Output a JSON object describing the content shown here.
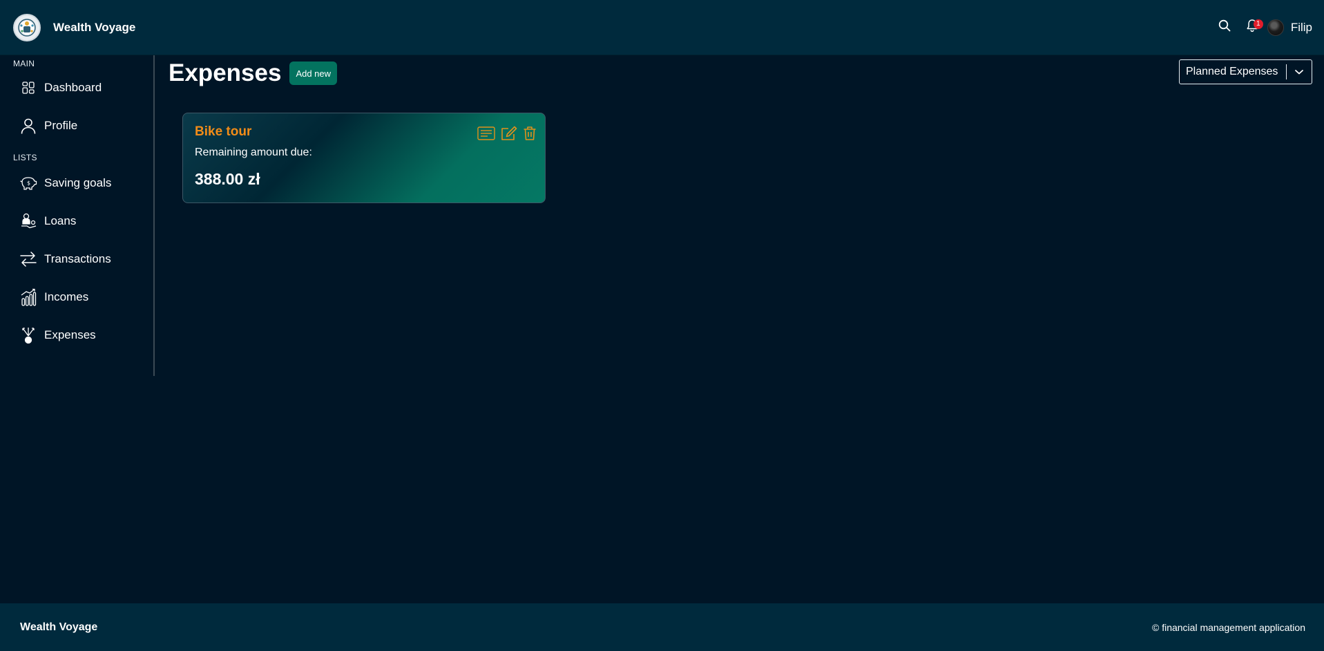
{
  "app": {
    "name": "Wealth Voyage"
  },
  "header": {
    "notification_count": "1",
    "user_name": "Filip"
  },
  "sidebar": {
    "sections": [
      {
        "label": "MAIN",
        "items": [
          {
            "label": "Dashboard",
            "icon": "dashboard-icon"
          },
          {
            "label": "Profile",
            "icon": "user-icon"
          }
        ]
      },
      {
        "label": "LISTS",
        "items": [
          {
            "label": "Saving goals",
            "icon": "piggy-bank-icon"
          },
          {
            "label": "Loans",
            "icon": "loan-icon"
          },
          {
            "label": "Transactions",
            "icon": "transfer-arrows-icon"
          },
          {
            "label": "Incomes",
            "icon": "bar-chart-icon"
          },
          {
            "label": "Expenses",
            "icon": "expenses-icon"
          }
        ]
      }
    ]
  },
  "main": {
    "title": "Expenses",
    "add_button": "Add new",
    "filter": {
      "selected": "Planned Expenses"
    },
    "cards": [
      {
        "title": "Bike tour",
        "subtitle": "Remaining amount due:",
        "amount": "388.00 zł"
      }
    ]
  },
  "footer": {
    "brand": "Wealth Voyage",
    "copyright": "© financial management application"
  },
  "colors": {
    "background": "#001526",
    "bar": "#002a3d",
    "accent_green": "#03735f",
    "card_title_orange": "#f28c18",
    "badge_red": "#e11d2b"
  }
}
